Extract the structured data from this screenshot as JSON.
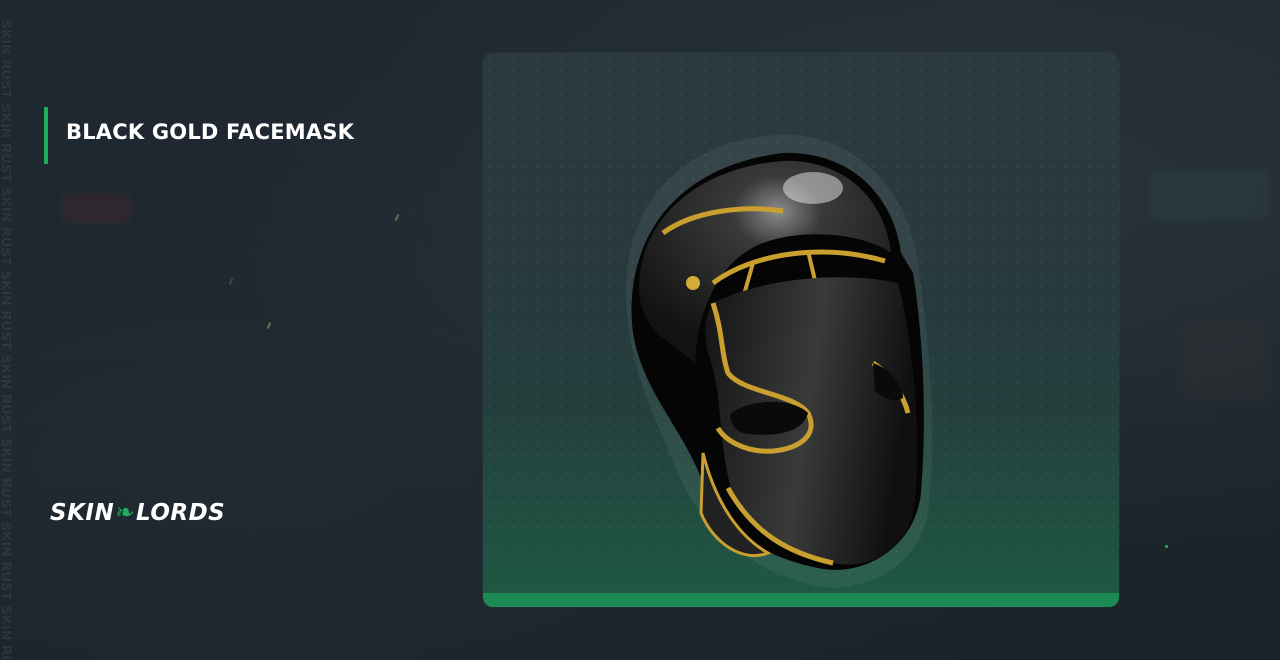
{
  "item": {
    "name": "BLACK GOLD FACEMASK"
  },
  "brand": {
    "logo_left": "SKIN",
    "logo_right": "LORDS",
    "watermark_text": "SKIN RUST SKIN RUST SKIN RUST SKIN RUST SKIN RUST SKIN RUST SKIN RUST SKIN RUST"
  },
  "colors": {
    "accent": "#1fae5c",
    "background": "#1c242c",
    "card_bar": "#1c8a55",
    "mask_gold": "#c9a030",
    "mask_black": "#1a1a1a"
  },
  "icons": {
    "logo_leaf": "leaf-icon"
  }
}
